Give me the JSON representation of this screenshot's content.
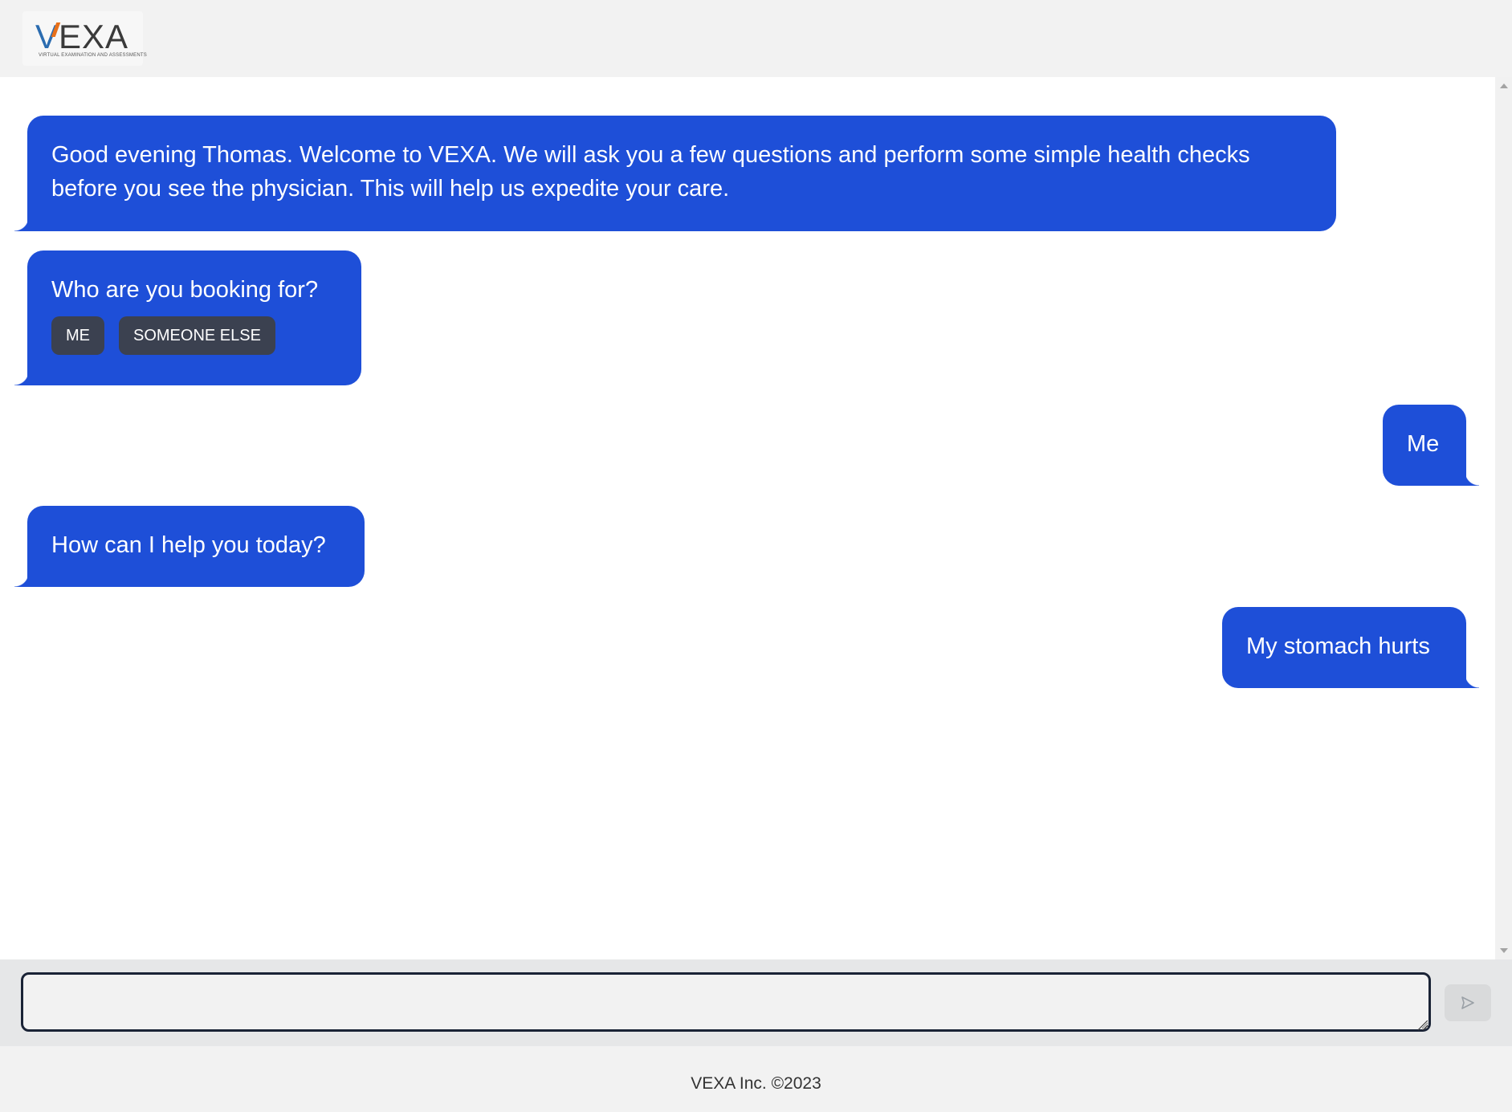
{
  "header": {
    "logo_text_v": "V",
    "logo_text_rest": "EXA",
    "logo_subtitle": "VIRTUAL EXAMINATION AND ASSESSMENTS"
  },
  "chat": {
    "messages": [
      {
        "sender": "bot",
        "text": "Good evening Thomas. Welcome to VEXA. We will ask you a few questions and perform some simple health checks before you see the physician. This will help us expedite your care."
      },
      {
        "sender": "bot",
        "text": "Who are you booking for?",
        "options": [
          "ME",
          "SOMEONE ELSE"
        ]
      },
      {
        "sender": "user",
        "text": "Me"
      },
      {
        "sender": "bot",
        "text": "How can I help you today?"
      },
      {
        "sender": "user",
        "text": "My stomach hurts"
      }
    ]
  },
  "composer": {
    "value": "",
    "send_icon": "send-arrow-icon"
  },
  "footer": {
    "text": "VEXA Inc. ©2023"
  },
  "colors": {
    "bubble": "#1e4fd8",
    "option_button": "#3b4150",
    "page_bg": "#f2f2f2"
  }
}
